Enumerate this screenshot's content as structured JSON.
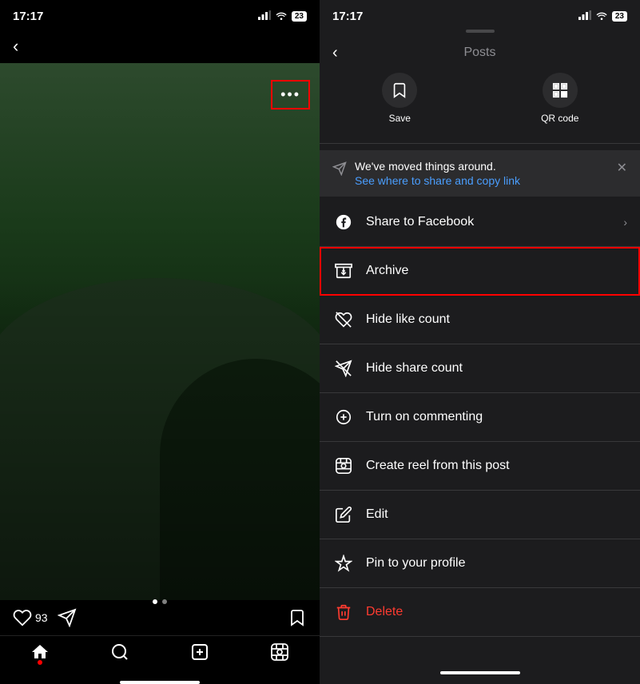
{
  "left": {
    "time": "17:17",
    "signal": "▂▄▆",
    "wifi": "WiFi",
    "battery": "23",
    "post": {
      "likes": "93",
      "dots": [
        true,
        false
      ]
    },
    "nav": {
      "items": [
        "home",
        "search",
        "add",
        "reels"
      ]
    },
    "three_dots": "•••"
  },
  "right": {
    "time": "17:17",
    "signal": "▂▄▆",
    "wifi": "WiFi",
    "battery": "23",
    "title": "Posts",
    "quick_actions": [
      {
        "label": "Save",
        "icon": "bookmark"
      },
      {
        "label": "QR code",
        "icon": "qr"
      }
    ],
    "info_banner": {
      "main_text": "We've moved things around.",
      "link_text": "See where to share and copy link"
    },
    "menu_items": [
      {
        "id": "share-facebook",
        "label": "Share to Facebook",
        "icon": "facebook",
        "has_chevron": true,
        "is_delete": false,
        "is_archive": false
      },
      {
        "id": "archive",
        "label": "Archive",
        "icon": "archive",
        "has_chevron": false,
        "is_delete": false,
        "is_archive": true
      },
      {
        "id": "hide-like",
        "label": "Hide like count",
        "icon": "heart-off",
        "has_chevron": false,
        "is_delete": false,
        "is_archive": false
      },
      {
        "id": "hide-share",
        "label": "Hide share count",
        "icon": "share-off",
        "has_chevron": false,
        "is_delete": false,
        "is_archive": false
      },
      {
        "id": "turn-commenting",
        "label": "Turn on commenting",
        "icon": "comment",
        "has_chevron": false,
        "is_delete": false,
        "is_archive": false
      },
      {
        "id": "create-reel",
        "label": "Create reel from this post",
        "icon": "reel",
        "has_chevron": false,
        "is_delete": false,
        "is_archive": false
      },
      {
        "id": "edit",
        "label": "Edit",
        "icon": "edit",
        "has_chevron": false,
        "is_delete": false,
        "is_archive": false
      },
      {
        "id": "pin",
        "label": "Pin to your profile",
        "icon": "pin",
        "has_chevron": false,
        "is_delete": false,
        "is_archive": false
      },
      {
        "id": "delete",
        "label": "Delete",
        "icon": "trash",
        "has_chevron": false,
        "is_delete": true,
        "is_archive": false
      }
    ]
  }
}
